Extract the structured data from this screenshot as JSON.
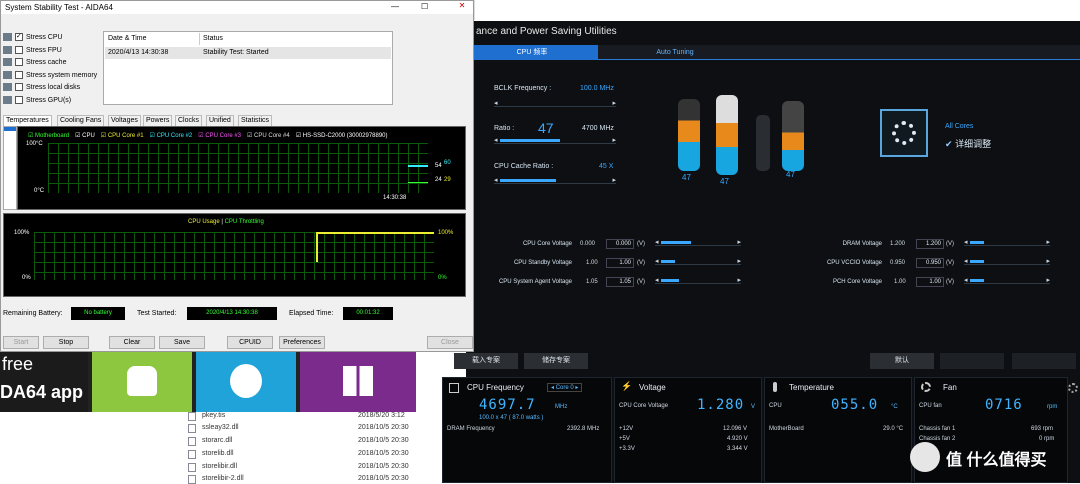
{
  "aida": {
    "title": "System Stability Test - AIDA64",
    "stress": [
      {
        "label": "Stress CPU",
        "checked": true
      },
      {
        "label": "Stress FPU",
        "checked": false
      },
      {
        "label": "Stress cache",
        "checked": false
      },
      {
        "label": "Stress system memory",
        "checked": false
      },
      {
        "label": "Stress local disks",
        "checked": false
      },
      {
        "label": "Stress GPU(s)",
        "checked": false
      }
    ],
    "log_headers": {
      "date": "Date & Time",
      "status": "Status"
    },
    "log_row": {
      "date": "2020/4/13 14:30:38",
      "status": "Stability Test: Started"
    },
    "tabs": [
      "Temperatures",
      "Cooling Fans",
      "Voltages",
      "Powers",
      "Clocks",
      "Unified",
      "Statistics"
    ],
    "legend": [
      "Motherboard",
      "CPU",
      "CPU Core #1",
      "CPU Core #2",
      "CPU Core #3",
      "CPU Core #4",
      "HS-SSD-C2000 (30002978890)"
    ],
    "temp_graph": {
      "ymax": "100°C",
      "ymin": "0°C",
      "time": "14:30:38",
      "r1": "54",
      "r1b": "60",
      "r2": "24",
      "r2b": "29"
    },
    "usage_graph": {
      "title_a": "CPU Usage",
      "sep": "|",
      "title_b": "CPU Throttling",
      "lmax": "100%",
      "lmin": "0%",
      "rmax": "100%",
      "rmin": "0%"
    },
    "remaining_battery_label": "Remaining Battery:",
    "remaining_battery": "No battery",
    "test_started_label": "Test Started:",
    "test_started": "2020/4/13 14:30:38",
    "elapsed_label": "Elapsed Time:",
    "elapsed": "00:01:32",
    "buttons": {
      "start": "Start",
      "stop": "Stop",
      "clear": "Clear",
      "save": "Save",
      "cpuid": "CPUID",
      "preferences": "Preferences",
      "close": "Close"
    }
  },
  "ai": {
    "title": "ance and Power Saving Utilities",
    "tab_cpu": "CPU 频率",
    "tab_auto": "Auto Tuning",
    "bclk_label": "BCLK Frequency :",
    "bclk_val": "100.0 MHz",
    "ratio_label": "Ratio :",
    "ratio_val": "47",
    "ratio_mhz": "4700 MHz",
    "cache_label": "CPU Cache Ratio :",
    "cache_val": "45 X",
    "core_values": [
      "47",
      "47",
      "47"
    ],
    "all_cores": "All Cores",
    "fine_tune": "详细调整",
    "volt_left": [
      {
        "label": "CPU Core Voltage",
        "a": "0.000",
        "b": "0.000",
        "u": "(V)"
      },
      {
        "label": "CPU Standby Voltage",
        "a": "1.00",
        "b": "1.00",
        "u": "(V)"
      },
      {
        "label": "CPU System Agent Voltage",
        "a": "1.05",
        "b": "1.05",
        "u": "(V)"
      }
    ],
    "volt_right": [
      {
        "label": "DRAM Voltage",
        "a": "1.200",
        "b": "1.200",
        "u": "(V)"
      },
      {
        "label": "CPU VCCIO Voltage",
        "a": "0.950",
        "b": "0.950",
        "u": "(V)"
      },
      {
        "label": "PCH Core Voltage",
        "a": "1.00",
        "b": "1.00",
        "u": "(V)"
      }
    ],
    "load_profile": "载入专案",
    "save_profile": "储存专案",
    "default": "默认",
    "cpu_freq": {
      "title": "CPU Frequency",
      "core": "Core 0",
      "value": "4697.7",
      "unit": "MHz",
      "sub": "100.0 x 47 ( 87.0 watts )",
      "dram_label": "DRAM Frequency",
      "dram_val": "2392.8 MHz"
    },
    "voltage": {
      "title": "Voltage",
      "main_label": "CPU Core Voltage",
      "main_val": "1.280",
      "unit": "V",
      "rows": [
        {
          "l": "+12V",
          "v": "12.096 V"
        },
        {
          "l": "+5V",
          "v": "4.920 V"
        },
        {
          "l": "+3.3V",
          "v": "3.344 V"
        }
      ]
    },
    "temperature": {
      "title": "Temperature",
      "main_label": "CPU",
      "main_val": "055.0",
      "unit": "°C",
      "mb_label": "MotherBoard",
      "mb_val": "29.0 °C"
    },
    "fan": {
      "title": "Fan",
      "main_label": "CPU fan",
      "main_val": "0716",
      "unit": "rpm",
      "rows": [
        {
          "l": "Chassis fan 1",
          "v": "693 rpm"
        },
        {
          "l": "Chassis fan 2",
          "v": "0 rpm"
        }
      ]
    }
  },
  "desktop": {
    "banner_free": "free",
    "banner_app": "DA64 app",
    "files": [
      {
        "name": "pkey.tis",
        "date": "2018/5/20 3:12"
      },
      {
        "name": "ssleay32.dll",
        "date": "2018/10/5 20:30"
      },
      {
        "name": "storarc.dll",
        "date": "2018/10/5 20:30"
      },
      {
        "name": "storelib.dll",
        "date": "2018/10/5 20:30"
      },
      {
        "name": "storelibir.dll",
        "date": "2018/10/5 20:30"
      },
      {
        "name": "storelibir-2.dll",
        "date": "2018/10/5 20:30"
      }
    ],
    "watermark": "值 什么值得买"
  }
}
